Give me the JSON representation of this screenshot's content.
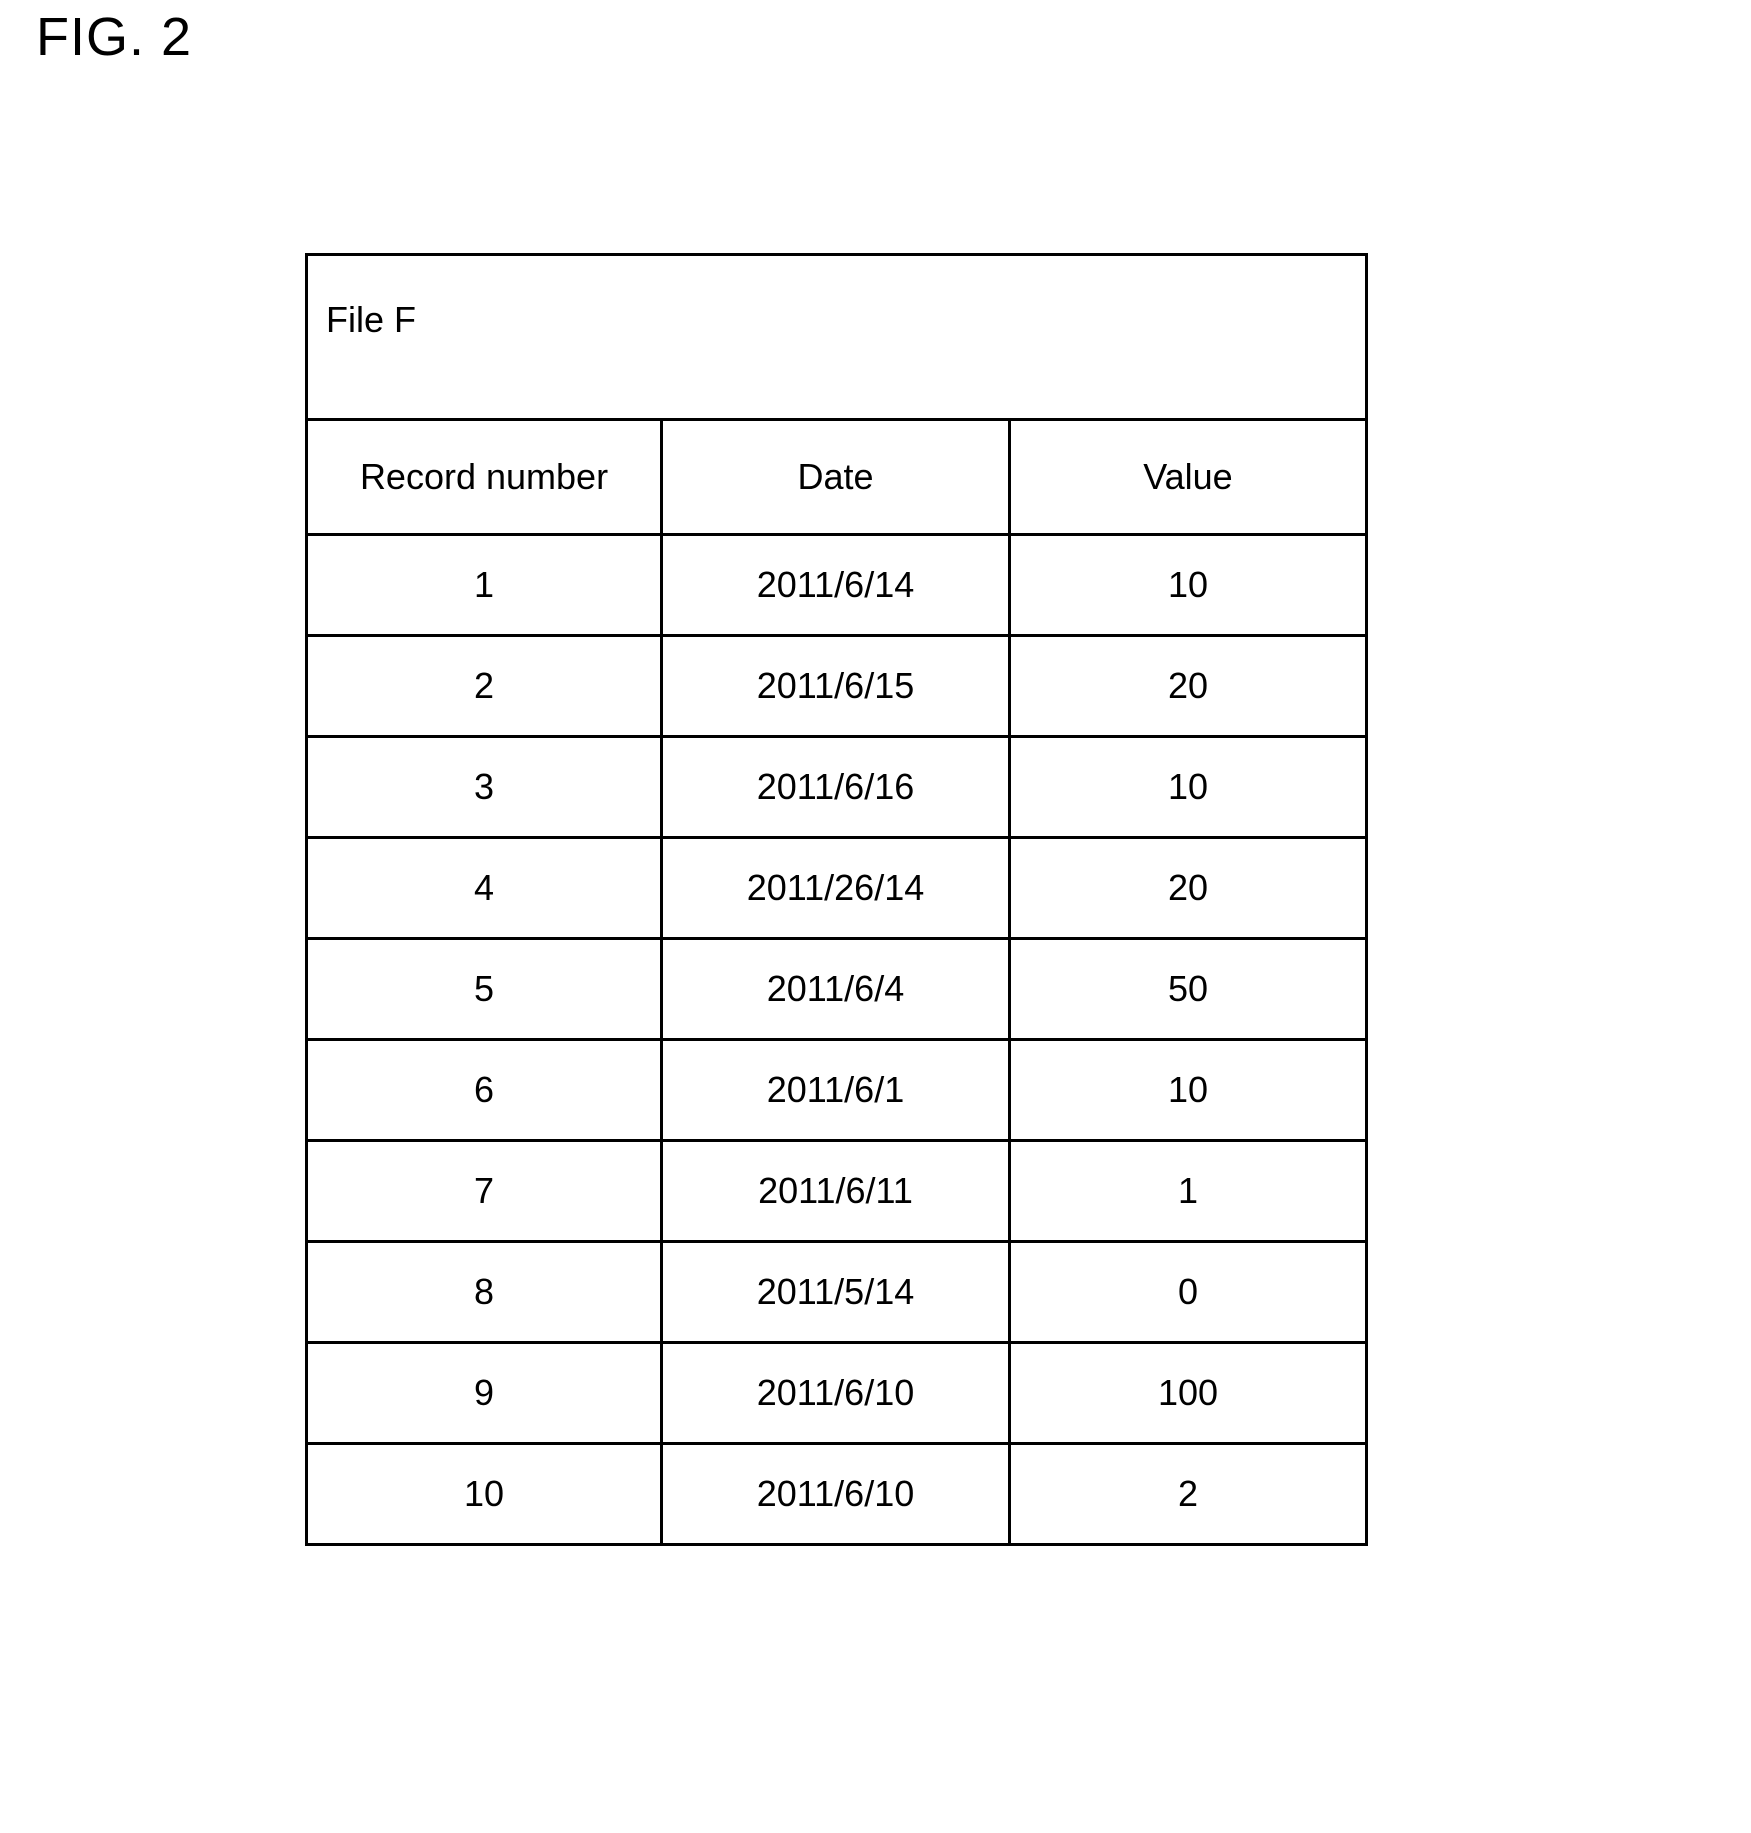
{
  "figure": {
    "label": "FIG. 2"
  },
  "table": {
    "title": "File F",
    "columns": [
      "Record number",
      "Date",
      "Value"
    ],
    "rows": [
      {
        "record_number": "1",
        "date": "2011/6/14",
        "value": "10"
      },
      {
        "record_number": "2",
        "date": "2011/6/15",
        "value": "20"
      },
      {
        "record_number": "3",
        "date": "2011/6/16",
        "value": "10"
      },
      {
        "record_number": "4",
        "date": "2011/26/14",
        "value": "20"
      },
      {
        "record_number": "5",
        "date": "2011/6/4",
        "value": "50"
      },
      {
        "record_number": "6",
        "date": "2011/6/1",
        "value": "10"
      },
      {
        "record_number": "7",
        "date": "2011/6/11",
        "value": "1"
      },
      {
        "record_number": "8",
        "date": "2011/5/14",
        "value": "0"
      },
      {
        "record_number": "9",
        "date": "2011/6/10",
        "value": "100"
      },
      {
        "record_number": "10",
        "date": "2011/6/10",
        "value": "2"
      }
    ]
  },
  "colors": {
    "ink": "#000000",
    "paper": "#ffffff"
  }
}
